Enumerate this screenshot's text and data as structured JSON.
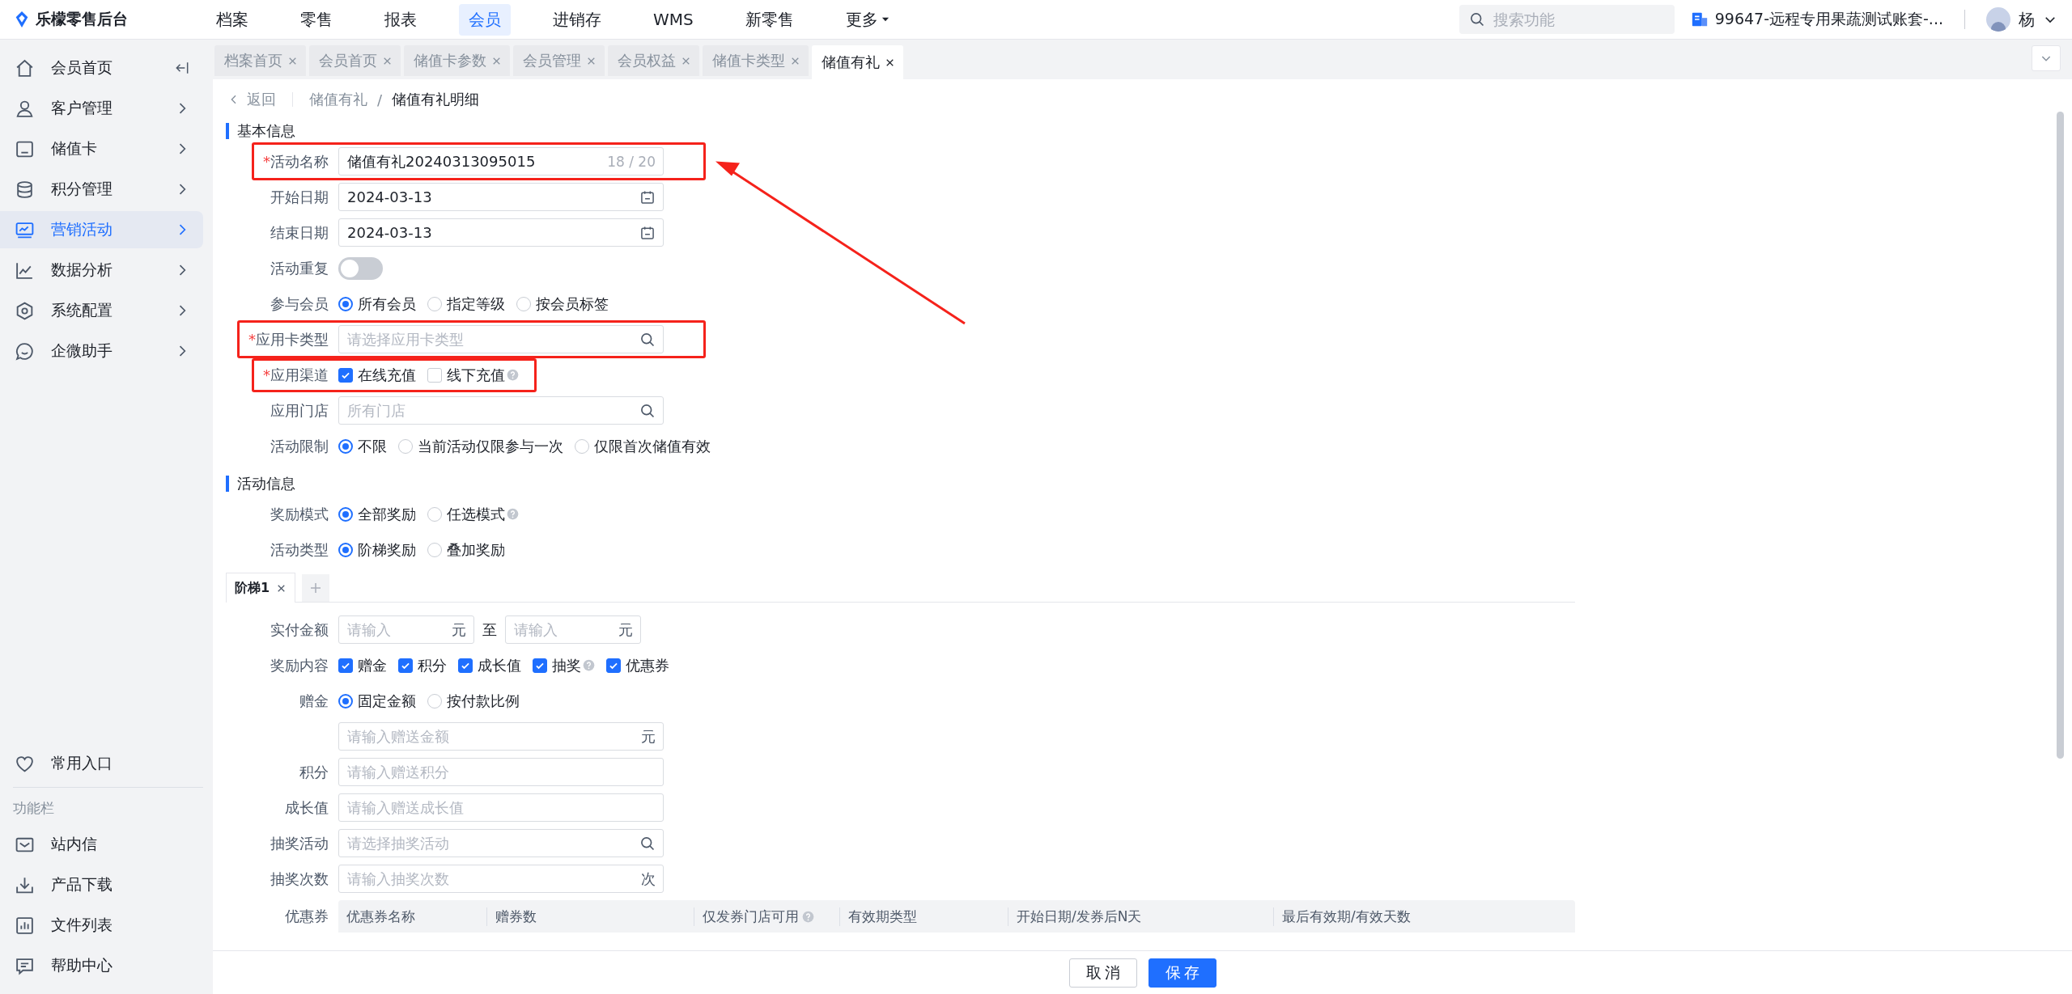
{
  "brand": {
    "name": "乐檬零售后台"
  },
  "top_nav": [
    {
      "label": "档案",
      "selected": false
    },
    {
      "label": "零售",
      "selected": false
    },
    {
      "label": "报表",
      "selected": false
    },
    {
      "label": "会员",
      "selected": true
    },
    {
      "label": "进销存",
      "selected": false
    },
    {
      "label": "WMS",
      "selected": false
    },
    {
      "label": "新零售",
      "selected": false
    },
    {
      "label": "更多",
      "selected": false,
      "dropdown": true
    }
  ],
  "search": {
    "placeholder": "搜索功能"
  },
  "account": {
    "name": "99647-远程专用果蔬测试账套-..."
  },
  "user": {
    "name": "杨"
  },
  "sidebar": {
    "items": [
      {
        "label": "会员首页",
        "selected": false
      },
      {
        "label": "客户管理",
        "selected": false
      },
      {
        "label": "储值卡",
        "selected": false
      },
      {
        "label": "积分管理",
        "selected": false
      },
      {
        "label": "营销活动",
        "selected": true
      },
      {
        "label": "数据分析",
        "selected": false
      },
      {
        "label": "系统配置",
        "selected": false
      },
      {
        "label": "企微助手",
        "selected": false
      }
    ],
    "favorite": {
      "label": "常用入口"
    },
    "section_title": "功能栏",
    "tools": [
      {
        "label": "站内信"
      },
      {
        "label": "产品下载"
      },
      {
        "label": "文件列表"
      },
      {
        "label": "帮助中心"
      }
    ]
  },
  "tabs": [
    {
      "label": "档案首页",
      "selected": false
    },
    {
      "label": "会员首页",
      "selected": false
    },
    {
      "label": "储值卡参数",
      "selected": false
    },
    {
      "label": "会员管理",
      "selected": false
    },
    {
      "label": "会员权益",
      "selected": false
    },
    {
      "label": "储值卡类型",
      "selected": false
    },
    {
      "label": "储值有礼",
      "selected": true
    }
  ],
  "breadcrumb": {
    "back": "返回",
    "items": [
      "储值有礼",
      "储值有礼明细"
    ],
    "separator": "/"
  },
  "sections": [
    {
      "title": "基本信息",
      "fields": [
        {
          "kind": "text",
          "mark": "*",
          "label": "活动名称",
          "value": "储值有礼20240313095015",
          "counter": "18 / 20",
          "highlighted": true
        },
        {
          "kind": "date",
          "label": "开始日期",
          "value": "2024-03-13"
        },
        {
          "kind": "date",
          "label": "结束日期",
          "value": "2024-03-13"
        },
        {
          "kind": "switch",
          "label": "活动重复",
          "on": false
        },
        {
          "kind": "radio",
          "label": "参与会员",
          "options": [
            {
              "label": "所有会员",
              "selected": true
            },
            {
              "label": "指定等级",
              "selected": false
            },
            {
              "label": "按会员标签",
              "selected": false
            }
          ]
        },
        {
          "kind": "select",
          "mark": "*",
          "label": "应用卡类型",
          "placeholder": "请选择应用卡类型",
          "highlighted": true
        },
        {
          "kind": "checkbox",
          "mark": "*",
          "label": "应用渠道",
          "highlighted": true,
          "options": [
            {
              "label": "在线充值",
              "checked": true
            },
            {
              "label": "线下充值",
              "checked": false,
              "help": true
            }
          ]
        },
        {
          "kind": "select",
          "label": "应用门店",
          "placeholder": "所有门店"
        },
        {
          "kind": "radio",
          "label": "活动限制",
          "options": [
            {
              "label": "不限",
              "selected": true
            },
            {
              "label": "当前活动仅限参与一次",
              "selected": false
            },
            {
              "label": "仅限首次储值有效",
              "selected": false
            }
          ]
        }
      ]
    },
    {
      "title": "活动信息",
      "fields": [
        {
          "kind": "radio",
          "label": "奖励模式",
          "options": [
            {
              "label": "全部奖励",
              "selected": true
            },
            {
              "label": "任选模式",
              "selected": false,
              "help": true
            }
          ]
        },
        {
          "kind": "radio",
          "label": "活动类型",
          "options": [
            {
              "label": "阶梯奖励",
              "selected": true
            },
            {
              "label": "叠加奖励",
              "selected": false
            }
          ]
        }
      ],
      "ladder": {
        "tabs": [
          {
            "label": "阶梯1",
            "selected": true
          }
        ],
        "fields": [
          {
            "kind": "range",
            "label": "实付金额",
            "from": {
              "placeholder": "请输入",
              "suffix": "元"
            },
            "separator": "至",
            "to": {
              "placeholder": "请输入",
              "suffix": "元"
            }
          },
          {
            "kind": "checkbox",
            "label": "奖励内容",
            "options": [
              {
                "label": "赠金",
                "checked": true
              },
              {
                "label": "积分",
                "checked": true
              },
              {
                "label": "成长值",
                "checked": true
              },
              {
                "label": "抽奖",
                "checked": true,
                "help": true
              },
              {
                "label": "优惠券",
                "checked": true
              }
            ]
          },
          {
            "kind": "radio",
            "label": "赠金",
            "options": [
              {
                "label": "固定金额",
                "selected": true
              },
              {
                "label": "按付款比例",
                "selected": false
              }
            ]
          },
          {
            "kind": "input",
            "placeholder": "请输入赠送金额",
            "suffix": "元"
          },
          {
            "kind": "input",
            "label": "积分",
            "placeholder": "请输入赠送积分"
          },
          {
            "kind": "input",
            "label": "成长值",
            "placeholder": "请输入赠送成长值"
          },
          {
            "kind": "select",
            "label": "抽奖活动",
            "placeholder": "请选择抽奖活动"
          },
          {
            "kind": "input",
            "label": "抽奖次数",
            "placeholder": "请输入抽奖次数",
            "suffix": "次"
          },
          {
            "kind": "table",
            "label": "优惠券",
            "columns": [
              {
                "label": "优惠券名称"
              },
              {
                "label": "赠券数"
              },
              {
                "label": "仅发券门店可用",
                "help": true
              },
              {
                "label": "有效期类型"
              },
              {
                "label": "开始日期/发券后N天"
              },
              {
                "label": "最后有效期/有效天数"
              }
            ]
          }
        ]
      }
    }
  ],
  "annotations": {
    "arrow": true
  },
  "footer": {
    "buttons": [
      {
        "label": "取消",
        "kind": "default"
      },
      {
        "label": "保存",
        "kind": "primary"
      }
    ]
  }
}
